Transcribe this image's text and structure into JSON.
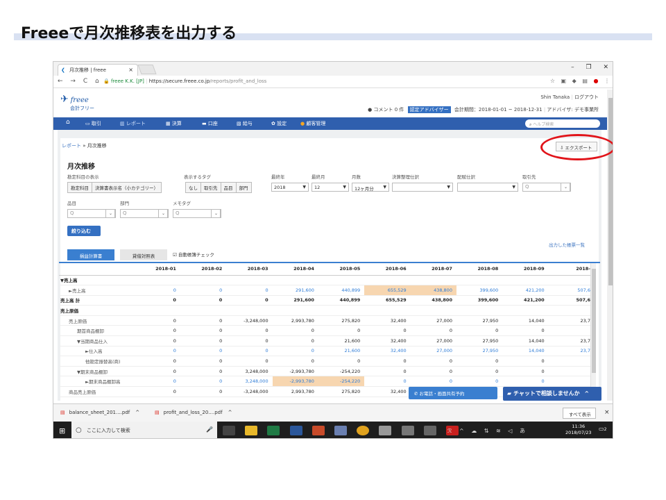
{
  "slide": {
    "title": "Freeeで月次推移表を出力する"
  },
  "browser": {
    "tab_title": "月次推移 | freee",
    "tab_close": "×",
    "window_controls": [
      "–",
      "❐",
      "✕"
    ],
    "nav": [
      "←",
      "→",
      "C",
      "⌂"
    ],
    "url_host": "freee K.K. [JP]",
    "url_base": "https://secure.freee.co.jp",
    "url_path": "/reports/profit_and_loss"
  },
  "header": {
    "logo_brand": "freee",
    "logo_sub": "会計フリー",
    "user_name": "Shin Tanaka",
    "logout": "ログアウト",
    "comment": "コメント 0 件",
    "advisor_badge": "認定アドバイザー",
    "period": "会計期間：2018-01-01 ~ 2018-12-31",
    "advisor": "アドバイザ: デモ事業所"
  },
  "gnav": {
    "items": [
      "取引",
      "レポート",
      "決算",
      "口座",
      "給与",
      "設定",
      "顧客管理"
    ],
    "search_placeholder": "ヘルプ検索"
  },
  "breadcrumb": {
    "parent": "レポート",
    "sep": "»",
    "current": "月次推移"
  },
  "export_label": "エクスポート",
  "page_title": "月次推移",
  "filters": {
    "account_display_label": "勘定科目の表示",
    "account_display_opts": [
      "勘定科目",
      "決算書表示名（小カテゴリー）"
    ],
    "tag_label": "表示するタグ",
    "tag_opts": [
      "なし",
      "取引先",
      "品目",
      "部門"
    ],
    "end_year_label": "最終年",
    "end_year": "2018",
    "end_month_label": "最終月",
    "end_month": "12",
    "months_label": "月数",
    "months": "12ヶ月分",
    "adjust_label": "決算整理仕訳",
    "alloc_label": "配賦仕訳",
    "partner_label": "取引先",
    "item_label": "品目",
    "dept_label": "部門",
    "memo_label": "メモタグ",
    "search_glyph": "Q",
    "filter_button": "絞り込む",
    "output_list": "出力した帳票一覧"
  },
  "report_tabs": {
    "pl": "損益計算書",
    "bs": "貸借対照表",
    "auto_check": "自動帳簿チェック"
  },
  "table": {
    "columns": [
      "",
      "2018-01",
      "2018-02",
      "2018-03",
      "2018-04",
      "2018-05",
      "2018-06",
      "2018-07",
      "2018-08",
      "2018-09",
      "2018-"
    ],
    "rows": [
      {
        "label": "▼売上高",
        "indent": 0,
        "bold": true,
        "cells": [
          "",
          "",
          "",
          "",
          "",
          "",
          "",
          "",
          "",
          ""
        ]
      },
      {
        "label": "►売上高",
        "indent": 1,
        "link": true,
        "cells": [
          "0",
          "0",
          "0",
          "291,600",
          "440,899",
          "655,529",
          "438,800",
          "399,600",
          "421,200",
          "507,6"
        ]
      },
      {
        "label": "売上高 計",
        "indent": 0,
        "bold": true,
        "cells": [
          "0",
          "0",
          "0",
          "291,600",
          "440,899",
          "655,529",
          "438,800",
          "399,600",
          "421,200",
          "507,6"
        ]
      },
      {
        "label": "売上原価",
        "indent": 0,
        "bold": true,
        "cells": [
          "",
          "",
          "",
          "",
          "",
          "",
          "",
          "",
          "",
          ""
        ]
      },
      {
        "label": "売上原価",
        "indent": 1,
        "cells": [
          "0",
          "0",
          "-3,248,000",
          "2,993,780",
          "275,820",
          "32,400",
          "27,000",
          "27,950",
          "14,040",
          "23,7"
        ]
      },
      {
        "label": "期首商品棚卸",
        "indent": 2,
        "cells": [
          "0",
          "0",
          "0",
          "0",
          "0",
          "0",
          "0",
          "0",
          "0",
          ""
        ]
      },
      {
        "label": "▼当期商品仕入",
        "indent": 2,
        "cells": [
          "0",
          "0",
          "0",
          "0",
          "21,600",
          "32,400",
          "27,000",
          "27,950",
          "14,040",
          "23,7"
        ]
      },
      {
        "label": "►仕入高",
        "indent": 3,
        "link": true,
        "cells": [
          "0",
          "0",
          "0",
          "0",
          "21,600",
          "32,400",
          "27,000",
          "27,950",
          "14,040",
          "23,7"
        ]
      },
      {
        "label": "他勘定振替高(商)",
        "indent": 3,
        "cells": [
          "0",
          "0",
          "0",
          "0",
          "0",
          "0",
          "0",
          "0",
          "0",
          ""
        ]
      },
      {
        "label": "▼期末商品棚卸",
        "indent": 2,
        "cells": [
          "0",
          "0",
          "3,248,000",
          "-2,993,780",
          "-254,220",
          "0",
          "0",
          "0",
          "0",
          ""
        ]
      },
      {
        "label": "►期末商品棚卸高",
        "indent": 3,
        "link": true,
        "cells": [
          "0",
          "0",
          "3,248,000",
          "-2,993,780",
          "-254,220",
          "0",
          "0",
          "0",
          "0",
          ""
        ]
      },
      {
        "label": "商品売上原価",
        "indent": 1,
        "cells": [
          "0",
          "0",
          "-3,248,000",
          "2,993,780",
          "275,820",
          "32,400",
          "",
          "",
          "",
          ""
        ]
      }
    ]
  },
  "floating": {
    "phone": "お電話・画面共有予約",
    "chat": "チャットで相談しませんか",
    "chat_caret": "^"
  },
  "downloads": {
    "items": [
      "balance_sheet_201....pdf",
      "profit_and_loss_20....pdf"
    ],
    "caret": "^",
    "show_all": "すべて表示",
    "close": "×"
  },
  "taskbar": {
    "search_placeholder": "ここに入力して検索",
    "time": "11:36",
    "date": "2018/07/23",
    "notif_count": "2"
  },
  "colors": {
    "nav_blue": "#2f5fae",
    "accent_blue": "#3a7fd0",
    "highlight": "#f7d6b0",
    "annotation_red": "#e1141a"
  }
}
